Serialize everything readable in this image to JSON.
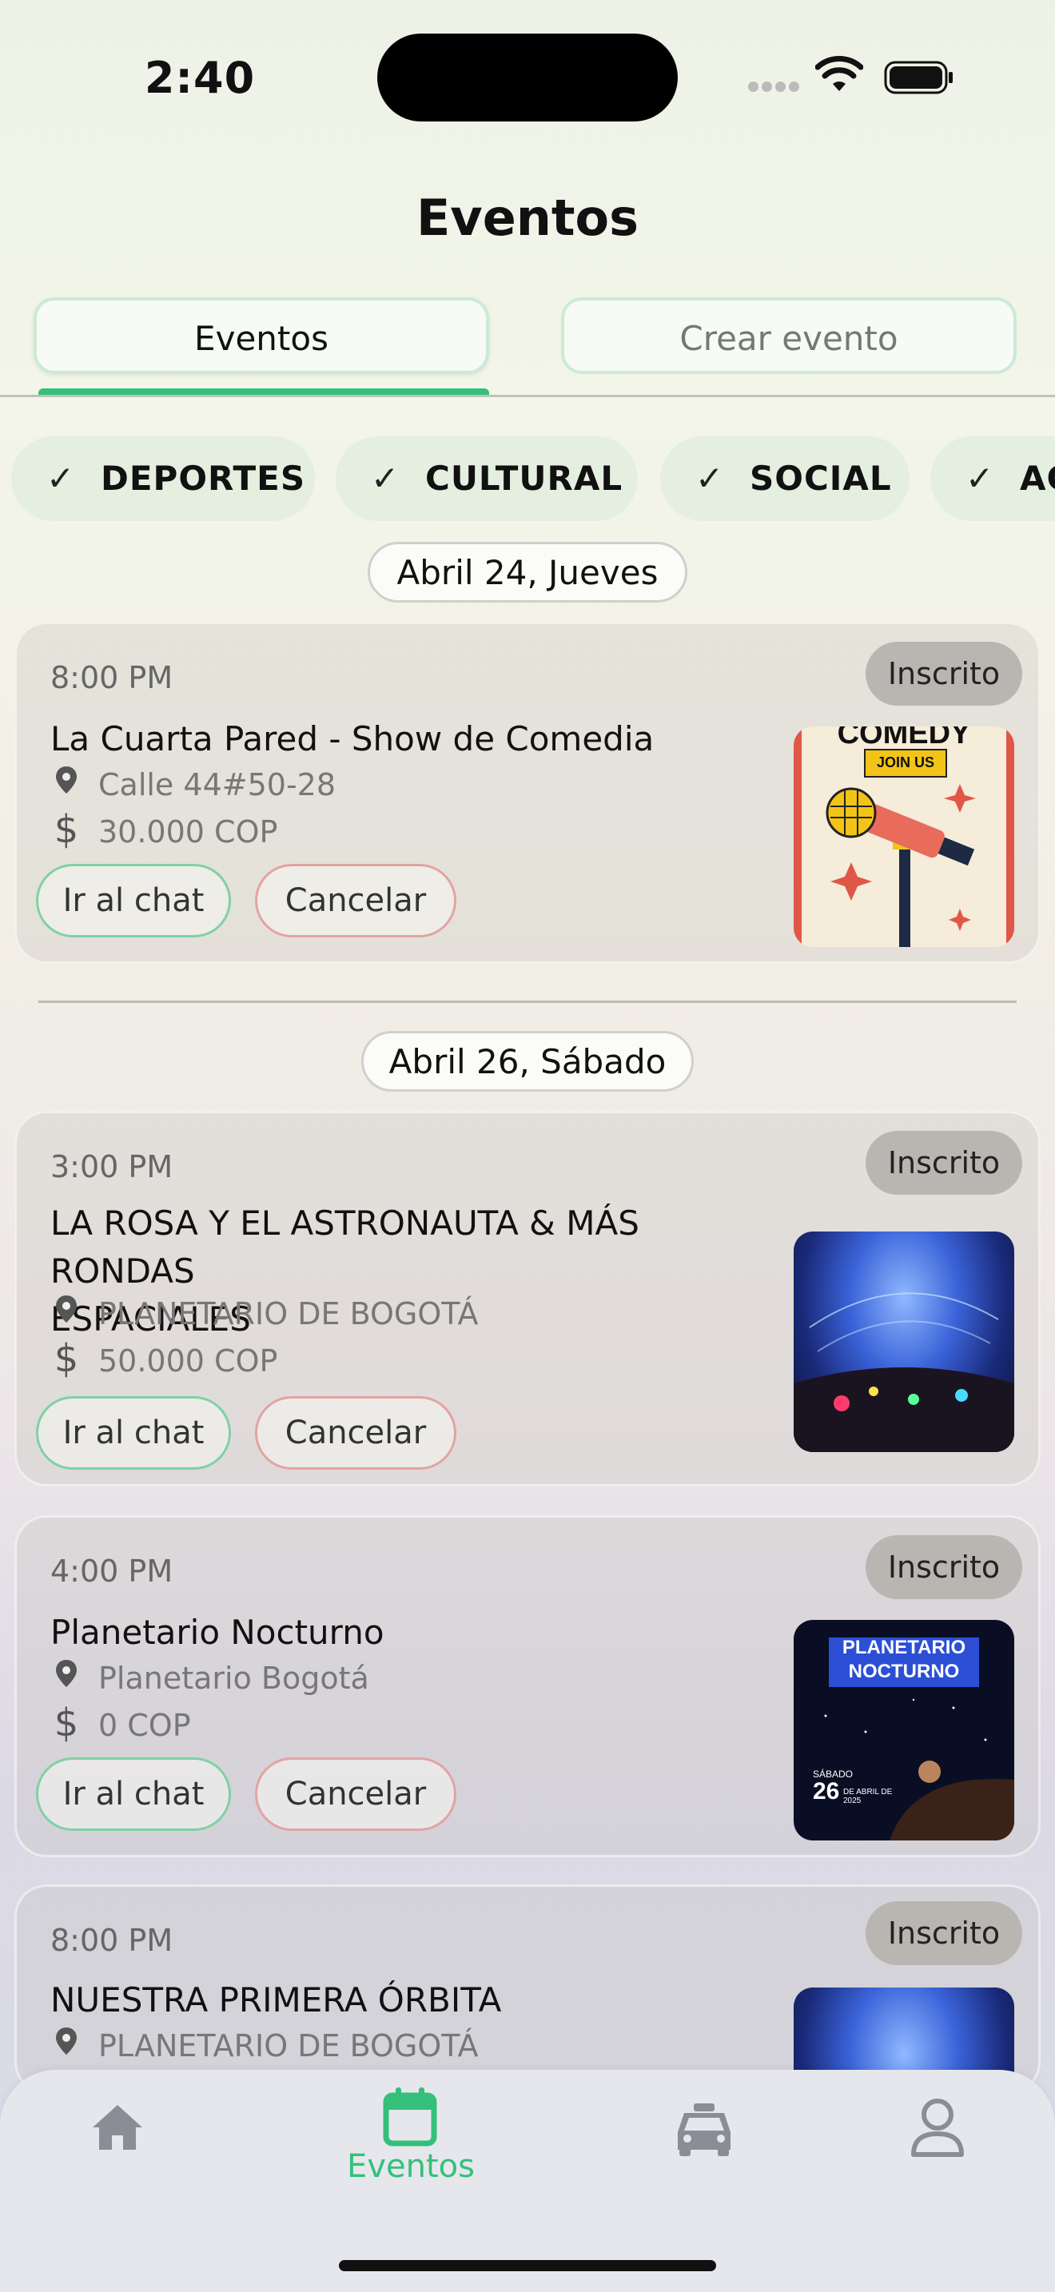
{
  "status": {
    "time": "2:40"
  },
  "header": {
    "title": "Eventos"
  },
  "tabs": [
    {
      "label": "Eventos",
      "active": true
    },
    {
      "label": "Crear evento",
      "active": false
    }
  ],
  "filters": [
    {
      "label": "DEPORTES"
    },
    {
      "label": "CULTURAL"
    },
    {
      "label": "SOCIAL"
    },
    {
      "label": "AC"
    }
  ],
  "sections": [
    {
      "date": "Abril 24, Jueves",
      "events": [
        {
          "time": "8:00 PM",
          "title": "La Cuarta Pared - Show de Comedia",
          "location": "Calle 44#50-28",
          "price": "30.000 COP",
          "status": "Inscrito",
          "chat_label": "Ir al chat",
          "cancel_label": "Cancelar",
          "image": "comedy-poster",
          "image_text": "COMEDY",
          "image_subtext": "JOIN US"
        }
      ]
    },
    {
      "date": "Abril 26, Sábado",
      "events": [
        {
          "time": "3:00 PM",
          "title_line1": "LA ROSA Y EL ASTRONAUTA & MÁS RONDAS",
          "title_line2": "ESPACIALES",
          "location": "PLANETARIO DE BOGOTÁ",
          "price": "50.000 COP",
          "status": "Inscrito",
          "chat_label": "Ir al chat",
          "cancel_label": "Cancelar",
          "image": "planetarium-dome"
        },
        {
          "time": "4:00 PM",
          "title": "Planetario Nocturno",
          "location": "Planetario Bogotá",
          "price": "0 COP",
          "status": "Inscrito",
          "chat_label": "Ir al chat",
          "cancel_label": "Cancelar",
          "image": "planetario-nocturno-poster",
          "image_title1": "PLANETARIO",
          "image_title2": "NOCTURNO",
          "image_day": "SÁBADO",
          "image_date": "26",
          "image_month": "DE ABRIL DE 2025"
        },
        {
          "time": "8:00 PM",
          "title": "NUESTRA PRIMERA ÓRBITA",
          "location": "PLANETARIO DE BOGOTÁ",
          "status": "Inscrito",
          "image": "planetarium-dome"
        }
      ]
    }
  ],
  "bottom_nav": [
    {
      "icon": "home-icon",
      "label": ""
    },
    {
      "icon": "calendar-icon",
      "label": "Eventos",
      "active": true
    },
    {
      "icon": "car-icon",
      "label": ""
    },
    {
      "icon": "profile-icon",
      "label": ""
    }
  ],
  "colors": {
    "accent": "#34c07a",
    "chip_bg": "#e4efe0",
    "cancel_border": "#e3a3a3",
    "chat_border": "#7fd1a4"
  }
}
